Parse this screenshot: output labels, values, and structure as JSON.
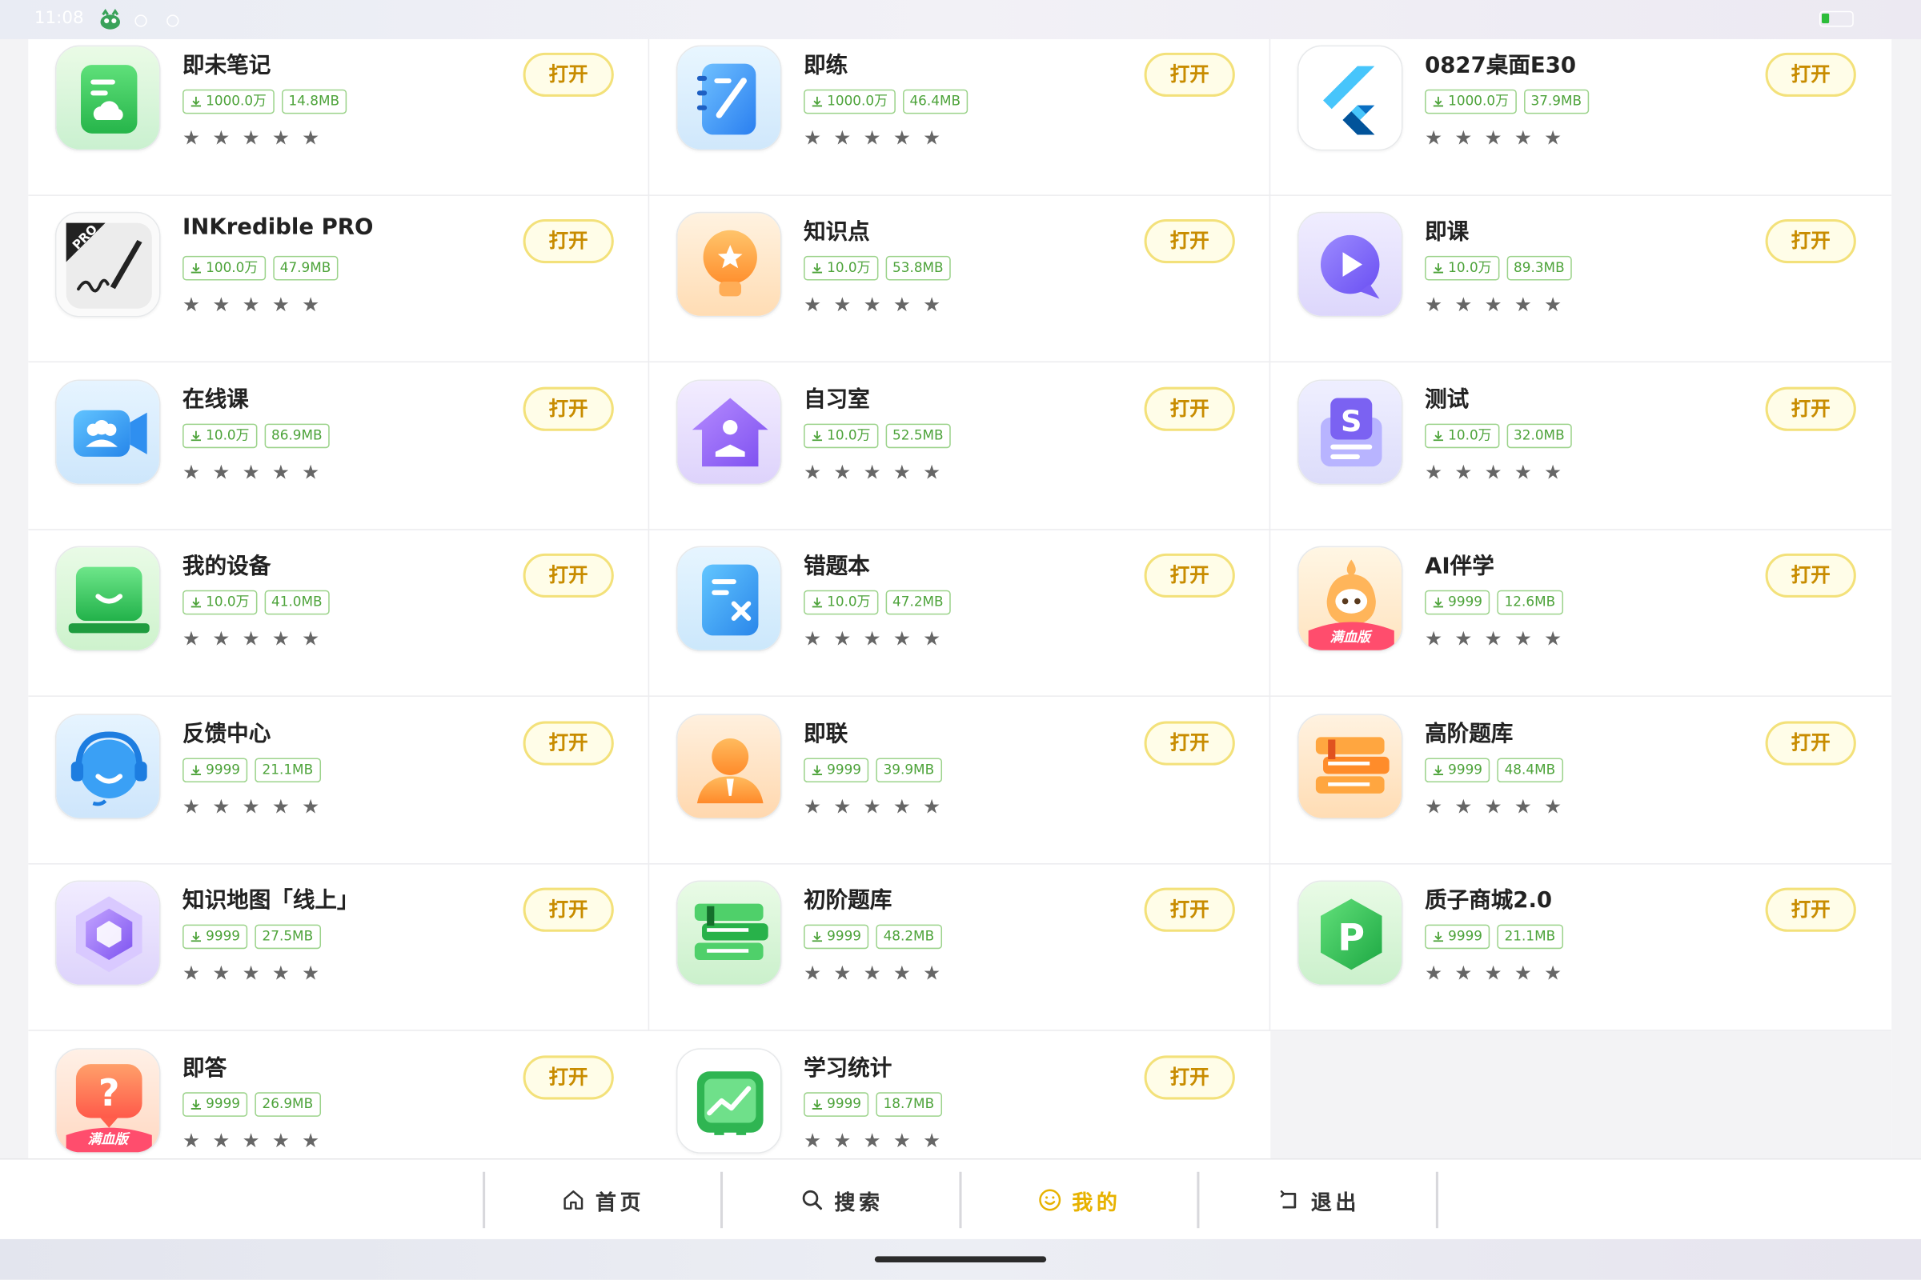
{
  "status_bar": {
    "time": "11:08",
    "battery_color": "#2dbd3a"
  },
  "colors": {
    "accent": "#e7b200",
    "button_border": "#f3e17a",
    "tag_green": "#4da33a"
  },
  "apps": [
    {
      "name": "即未笔记",
      "downloads": "1000.0万",
      "size": "14.8MB",
      "open_label": "打开",
      "icon": "note-icon",
      "rating_stars": 5
    },
    {
      "name": "即练",
      "downloads": "1000.0万",
      "size": "46.4MB",
      "open_label": "打开",
      "icon": "notebook-pen-icon",
      "rating_stars": 5
    },
    {
      "name": "0827桌面E30",
      "downloads": "1000.0万",
      "size": "37.9MB",
      "open_label": "打开",
      "icon": "flutter-icon",
      "rating_stars": 5
    },
    {
      "name": "INKredible PRO",
      "downloads": "100.0万",
      "size": "47.9MB",
      "open_label": "打开",
      "icon": "pen-pro-icon",
      "rating_stars": 5
    },
    {
      "name": "知识点",
      "downloads": "10.0万",
      "size": "53.8MB",
      "open_label": "打开",
      "icon": "lightbulb-star-icon",
      "rating_stars": 5
    },
    {
      "name": "即课",
      "downloads": "10.0万",
      "size": "89.3MB",
      "open_label": "打开",
      "icon": "play-chat-icon",
      "rating_stars": 5
    },
    {
      "name": "在线课",
      "downloads": "10.0万",
      "size": "86.9MB",
      "open_label": "打开",
      "icon": "video-group-icon",
      "rating_stars": 5
    },
    {
      "name": "自习室",
      "downloads": "10.0万",
      "size": "52.5MB",
      "open_label": "打开",
      "icon": "study-house-icon",
      "rating_stars": 5
    },
    {
      "name": "测试",
      "downloads": "10.0万",
      "size": "32.0MB",
      "open_label": "打开",
      "icon": "test-paper-icon",
      "rating_stars": 5
    },
    {
      "name": "我的设备",
      "downloads": "10.0万",
      "size": "41.0MB",
      "open_label": "打开",
      "icon": "laptop-smile-icon",
      "rating_stars": 5
    },
    {
      "name": "错题本",
      "downloads": "10.0万",
      "size": "47.2MB",
      "open_label": "打开",
      "icon": "wrong-book-icon",
      "rating_stars": 5
    },
    {
      "name": "AI伴学",
      "downloads": "9999",
      "size": "12.6MB",
      "open_label": "打开",
      "icon": "ai-mascot-icon",
      "badge": "满血版",
      "rating_stars": 5
    },
    {
      "name": "反馈中心",
      "downloads": "9999",
      "size": "21.1MB",
      "open_label": "打开",
      "icon": "headset-icon",
      "rating_stars": 5
    },
    {
      "name": "即联",
      "downloads": "9999",
      "size": "39.9MB",
      "open_label": "打开",
      "icon": "contact-person-icon",
      "rating_stars": 5
    },
    {
      "name": "高阶题库",
      "downloads": "9999",
      "size": "48.4MB",
      "open_label": "打开",
      "icon": "book-stack-orange-icon",
      "rating_stars": 5
    },
    {
      "name": "知识地图「线上」",
      "downloads": "9999",
      "size": "27.5MB",
      "open_label": "打开",
      "icon": "hexagon-cube-icon",
      "rating_stars": 5
    },
    {
      "name": "初阶题库",
      "downloads": "9999",
      "size": "48.2MB",
      "open_label": "打开",
      "icon": "book-stack-green-icon",
      "rating_stars": 5
    },
    {
      "name": "质子商城2.0",
      "downloads": "9999",
      "size": "21.1MB",
      "open_label": "打开",
      "icon": "p-hexagon-icon",
      "rating_stars": 5
    },
    {
      "name": "即答",
      "downloads": "9999",
      "size": "26.9MB",
      "open_label": "打开",
      "icon": "question-bubble-icon",
      "badge": "满血版",
      "rating_stars": 5
    },
    {
      "name": "学习统计",
      "downloads": "9999",
      "size": "18.7MB",
      "open_label": "打开",
      "icon": "stats-chart-icon",
      "rating_stars": 5
    }
  ],
  "nav": {
    "items": [
      {
        "label": "首页",
        "icon": "home-icon",
        "active": false
      },
      {
        "label": "搜索",
        "icon": "search-icon",
        "active": false
      },
      {
        "label": "我的",
        "icon": "smiley-icon",
        "active": true
      },
      {
        "label": "退出",
        "icon": "exit-icon",
        "active": false
      }
    ]
  }
}
